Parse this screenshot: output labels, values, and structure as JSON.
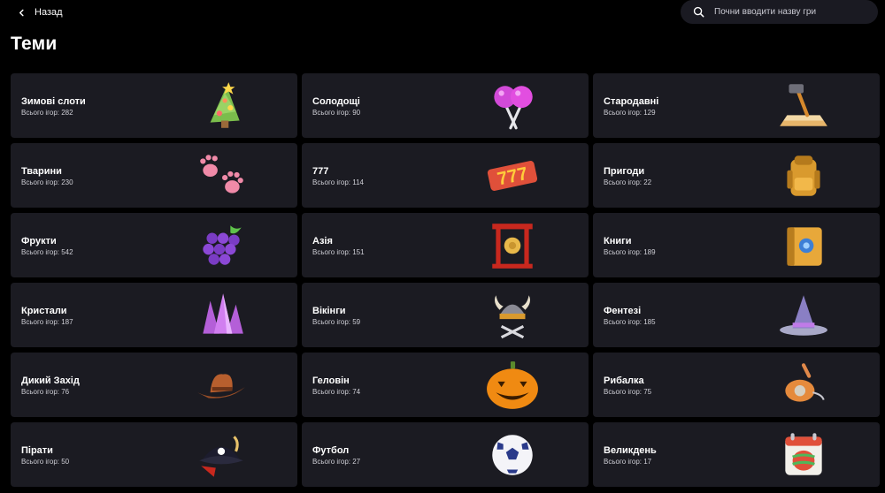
{
  "header": {
    "back_label": "Назад",
    "search_placeholder": "Почни вводити назву гри"
  },
  "page_title": "Теми",
  "count_prefix": "Всього ігор:",
  "themes": [
    {
      "name": "Зимові слоти",
      "count_text": "Всього ігор: 282",
      "icon": "christmas-tree-icon"
    },
    {
      "name": "Солодощі",
      "count_text": "Всього ігор: 90",
      "icon": "lollipop-icon"
    },
    {
      "name": "Стародавні",
      "count_text": "Всього ігор: 129",
      "icon": "hammer-icon"
    },
    {
      "name": "Тварини",
      "count_text": "Всього ігор: 230",
      "icon": "paw-icon"
    },
    {
      "name": "777",
      "count_text": "Всього ігор: 114",
      "icon": "sevens-icon"
    },
    {
      "name": "Пригоди",
      "count_text": "Всього ігор: 22",
      "icon": "backpack-icon"
    },
    {
      "name": "Фрукти",
      "count_text": "Всього ігор: 542",
      "icon": "grapes-icon"
    },
    {
      "name": "Азія",
      "count_text": "Всього ігор: 151",
      "icon": "gong-icon"
    },
    {
      "name": "Книги",
      "count_text": "Всього ігор: 189",
      "icon": "book-icon"
    },
    {
      "name": "Кристали",
      "count_text": "Всього ігор: 187",
      "icon": "crystal-icon"
    },
    {
      "name": "Вікінги",
      "count_text": "Всього ігор: 59",
      "icon": "viking-helmet-icon"
    },
    {
      "name": "Фентезі",
      "count_text": "Всього ігор: 185",
      "icon": "wizard-hat-icon"
    },
    {
      "name": "Дикий Захід",
      "count_text": "Всього ігор: 76",
      "icon": "cowboy-hat-icon"
    },
    {
      "name": "Геловін",
      "count_text": "Всього ігор: 74",
      "icon": "pumpkin-icon"
    },
    {
      "name": "Рибалка",
      "count_text": "Всього ігор: 75",
      "icon": "fishing-reel-icon"
    },
    {
      "name": "Пірати",
      "count_text": "Всього ігор: 50",
      "icon": "pirate-hat-icon"
    },
    {
      "name": "Футбол",
      "count_text": "Всього ігор: 27",
      "icon": "soccer-ball-icon"
    },
    {
      "name": "Великдень",
      "count_text": "Всього ігор: 17",
      "icon": "easter-calendar-icon"
    }
  ],
  "colors": {
    "background": "#000000",
    "card": "#1b1b22",
    "search_bg": "#1a1a22"
  }
}
